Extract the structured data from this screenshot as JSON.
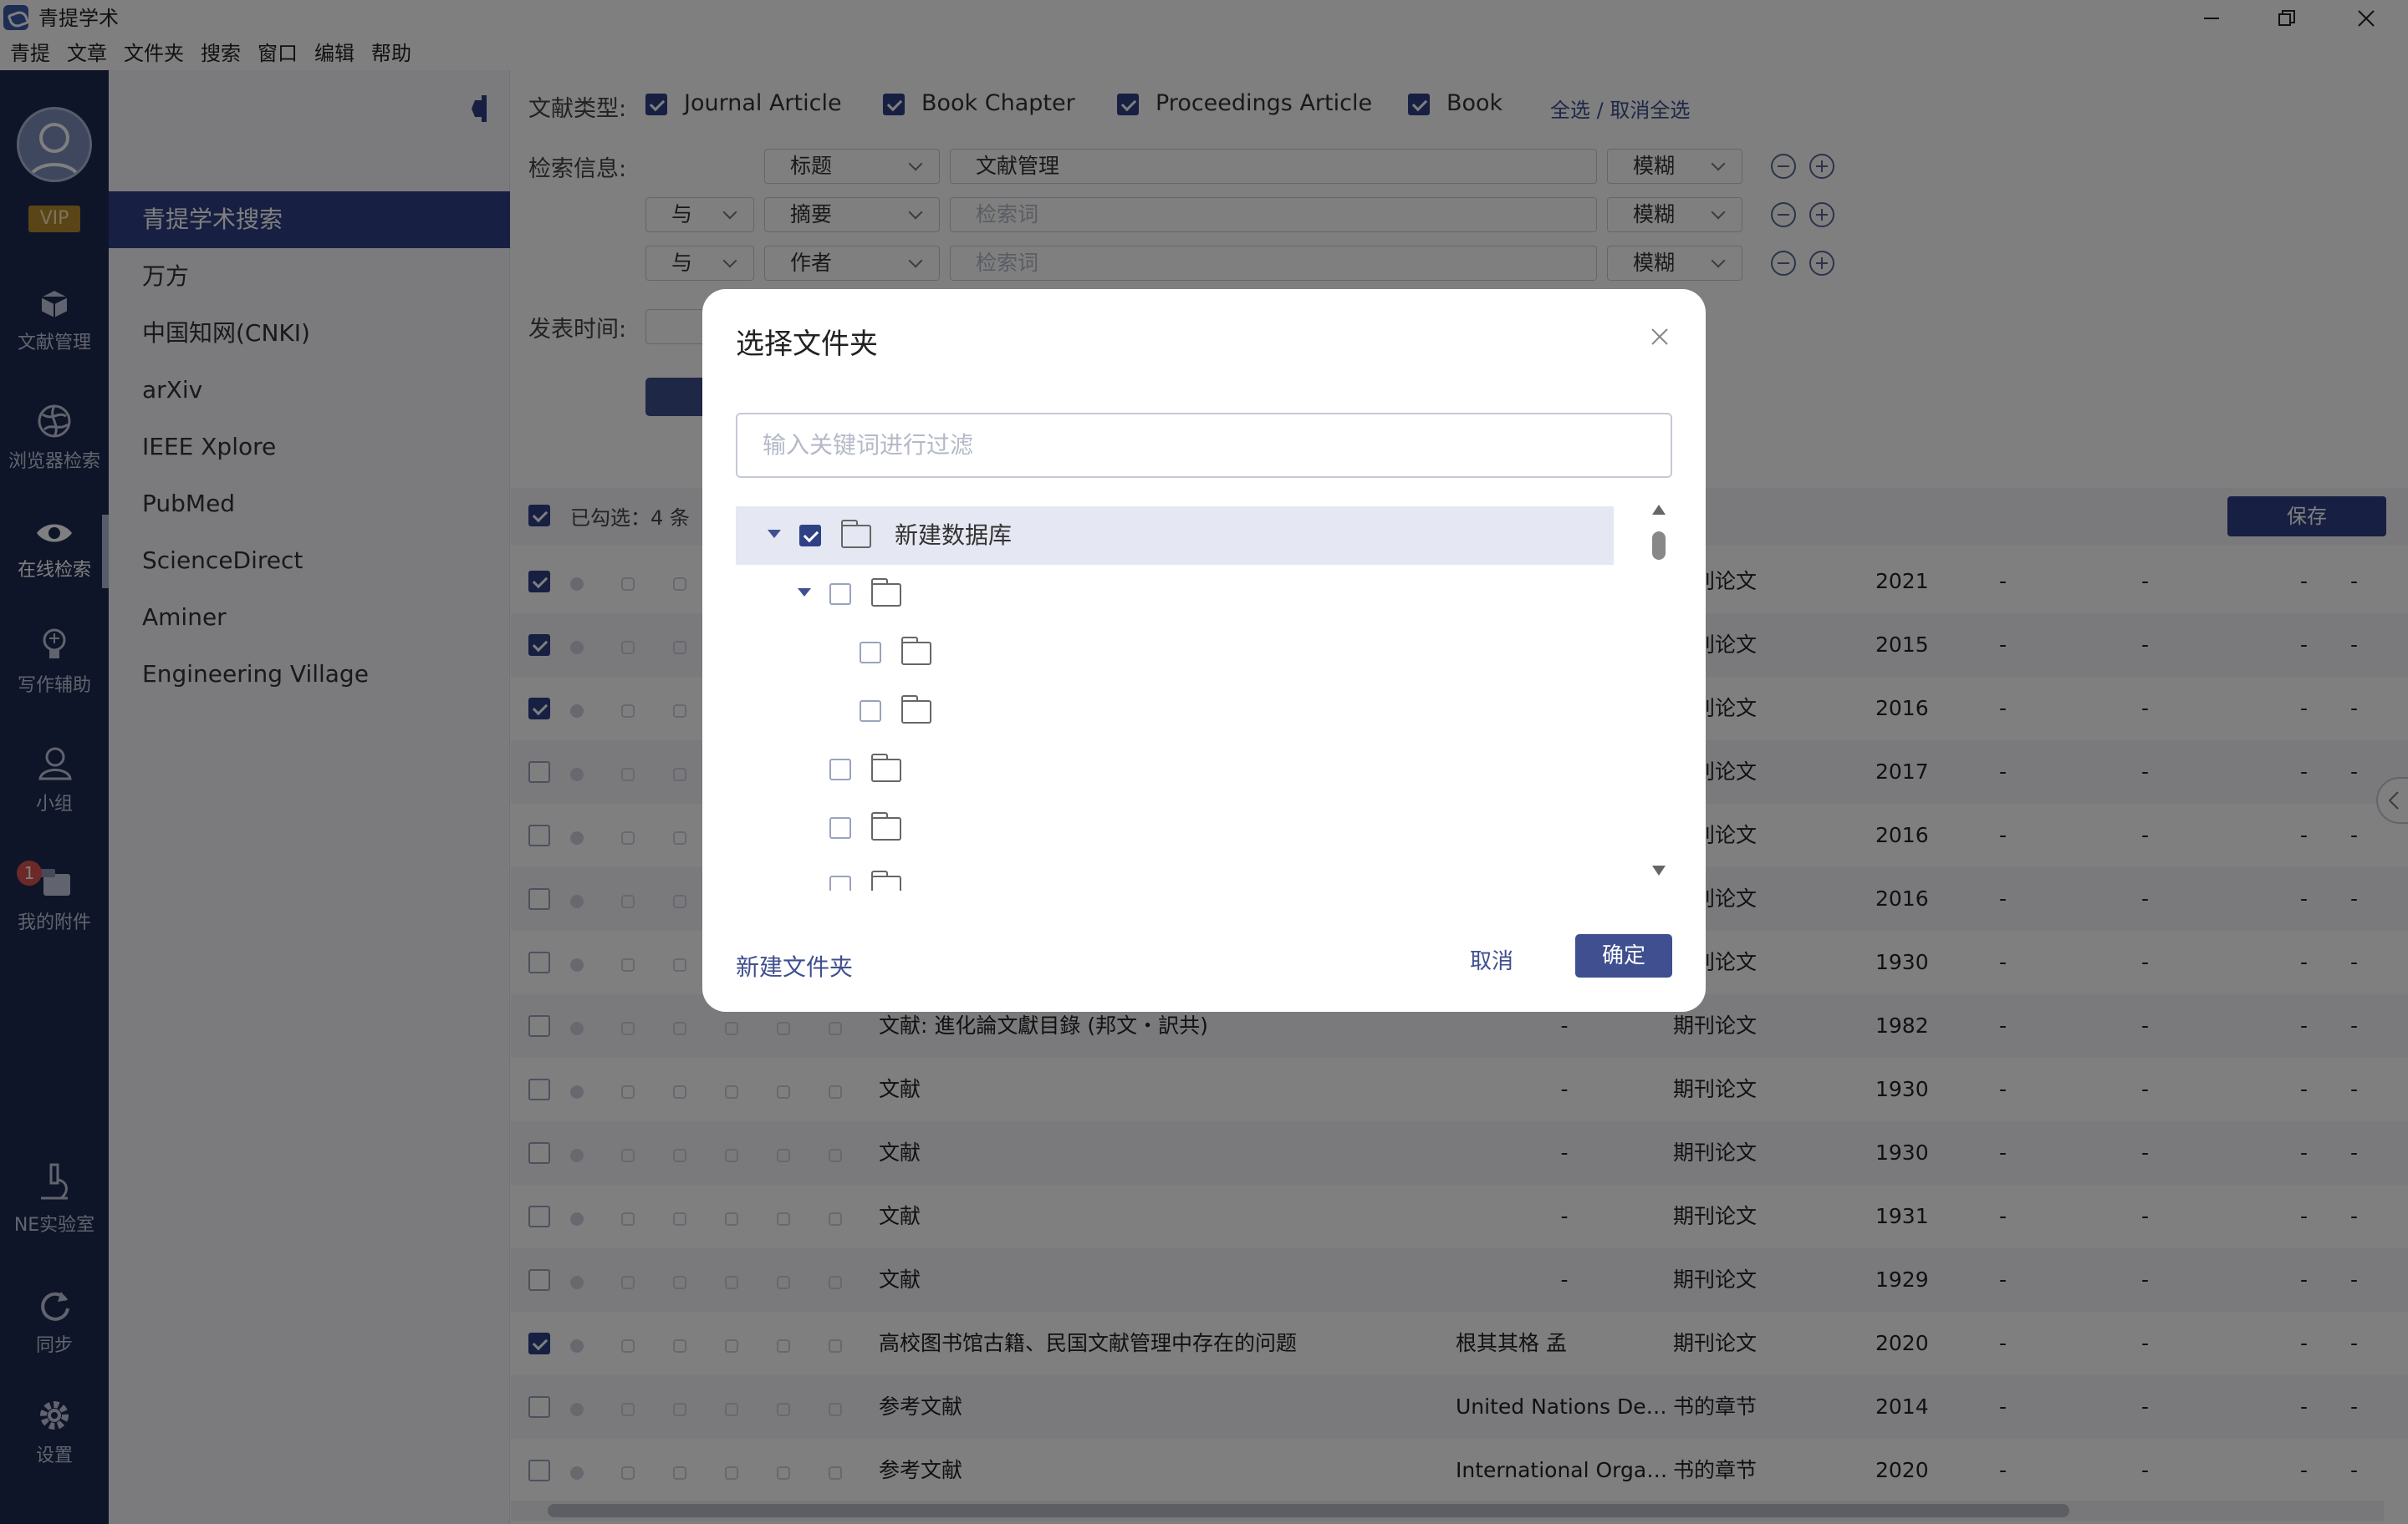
{
  "app": {
    "title": "青提学术"
  },
  "menu": [
    "青提",
    "文章",
    "文件夹",
    "搜索",
    "窗口",
    "编辑",
    "帮助"
  ],
  "iconbar": {
    "vip": "VIP",
    "items": [
      {
        "label": "文献管理",
        "icon": "box-icon"
      },
      {
        "label": "浏览器检索",
        "icon": "globe-icon"
      },
      {
        "label": "在线检索",
        "icon": "eye-icon"
      },
      {
        "label": "写作辅助",
        "icon": "lightbulb-icon"
      },
      {
        "label": "小组",
        "icon": "group-icon"
      },
      {
        "label": "我的附件",
        "icon": "attachment-icon",
        "badge": "1"
      }
    ],
    "bottom": [
      {
        "label": "NE实验室",
        "icon": "microscope-icon"
      },
      {
        "label": "同步",
        "icon": "sync-icon"
      },
      {
        "label": "设置",
        "icon": "gear-icon"
      }
    ]
  },
  "sources": [
    "青提学术搜索",
    "万方",
    "中国知网(CNKI)",
    "arXiv",
    "IEEE Xplore",
    "PubMed",
    "ScienceDirect",
    "Aminer",
    "Engineering Village"
  ],
  "search": {
    "doc_type_label": "文献类型:",
    "doc_types": [
      "Journal Article",
      "Book Chapter",
      "Proceedings Article",
      "Book"
    ],
    "select_all": "全选 / 取消全选",
    "info_label": "检索信息:",
    "rows": [
      {
        "logic": "",
        "field": "标题",
        "value": "文献管理",
        "placeholder": "",
        "mode": "模糊"
      },
      {
        "logic": "与",
        "field": "摘要",
        "value": "",
        "placeholder": "检索词",
        "mode": "模糊"
      },
      {
        "logic": "与",
        "field": "作者",
        "value": "",
        "placeholder": "检索词",
        "mode": "模糊"
      }
    ],
    "date_label": "发表时间:"
  },
  "results": {
    "selected_text": "已勾选：4 条",
    "save": "保存",
    "rows": [
      {
        "checked": true,
        "title": "",
        "author": "",
        "type": "期刊论文",
        "year": "2021"
      },
      {
        "checked": true,
        "title": "",
        "author": "",
        "type": "期刊论文",
        "year": "2015"
      },
      {
        "checked": true,
        "title": "",
        "author": "",
        "type": "期刊论文",
        "year": "2016"
      },
      {
        "checked": false,
        "title": "",
        "author": "",
        "type": "期刊论文",
        "year": "2017"
      },
      {
        "checked": false,
        "title": "",
        "author": "",
        "type": "期刊论文",
        "year": "2016"
      },
      {
        "checked": false,
        "title": "",
        "author": "",
        "type": "期刊论文",
        "year": "2016"
      },
      {
        "checked": false,
        "title": "",
        "author": "",
        "type": "期刊论文",
        "year": "1930"
      },
      {
        "checked": false,
        "title": "文献: 進化論文獻目錄 (邦文・訳共)",
        "author": "-",
        "type": "期刊论文",
        "year": "1982"
      },
      {
        "checked": false,
        "title": "文献",
        "author": "-",
        "type": "期刊论文",
        "year": "1930"
      },
      {
        "checked": false,
        "title": "文献",
        "author": "-",
        "type": "期刊论文",
        "year": "1930"
      },
      {
        "checked": false,
        "title": "文献",
        "author": "-",
        "type": "期刊论文",
        "year": "1931"
      },
      {
        "checked": false,
        "title": "文献",
        "author": "-",
        "type": "期刊论文",
        "year": "1929"
      },
      {
        "checked": true,
        "title": "高校图书馆古籍、民国文献管理中存在的问题",
        "author": "根其其格 孟",
        "type": "期刊论文",
        "year": "2020"
      },
      {
        "checked": false,
        "title": "参考文献",
        "author": "United Nations Dev…",
        "type": "书的章节",
        "year": "2014"
      },
      {
        "checked": false,
        "title": "参考文献",
        "author": "International Organi…",
        "type": "书的章节",
        "year": "2020"
      }
    ],
    "dash": "-"
  },
  "dialog": {
    "title": "选择文件夹",
    "filter_placeholder": "输入关键词进行过滤",
    "root": "新建数据库",
    "new_folder": "新建文件夹",
    "cancel": "取消",
    "ok": "确定"
  },
  "colors": {
    "primary": "#3f4f8f",
    "sidebar": "#1e2a50",
    "source_active": "#2f4184"
  }
}
